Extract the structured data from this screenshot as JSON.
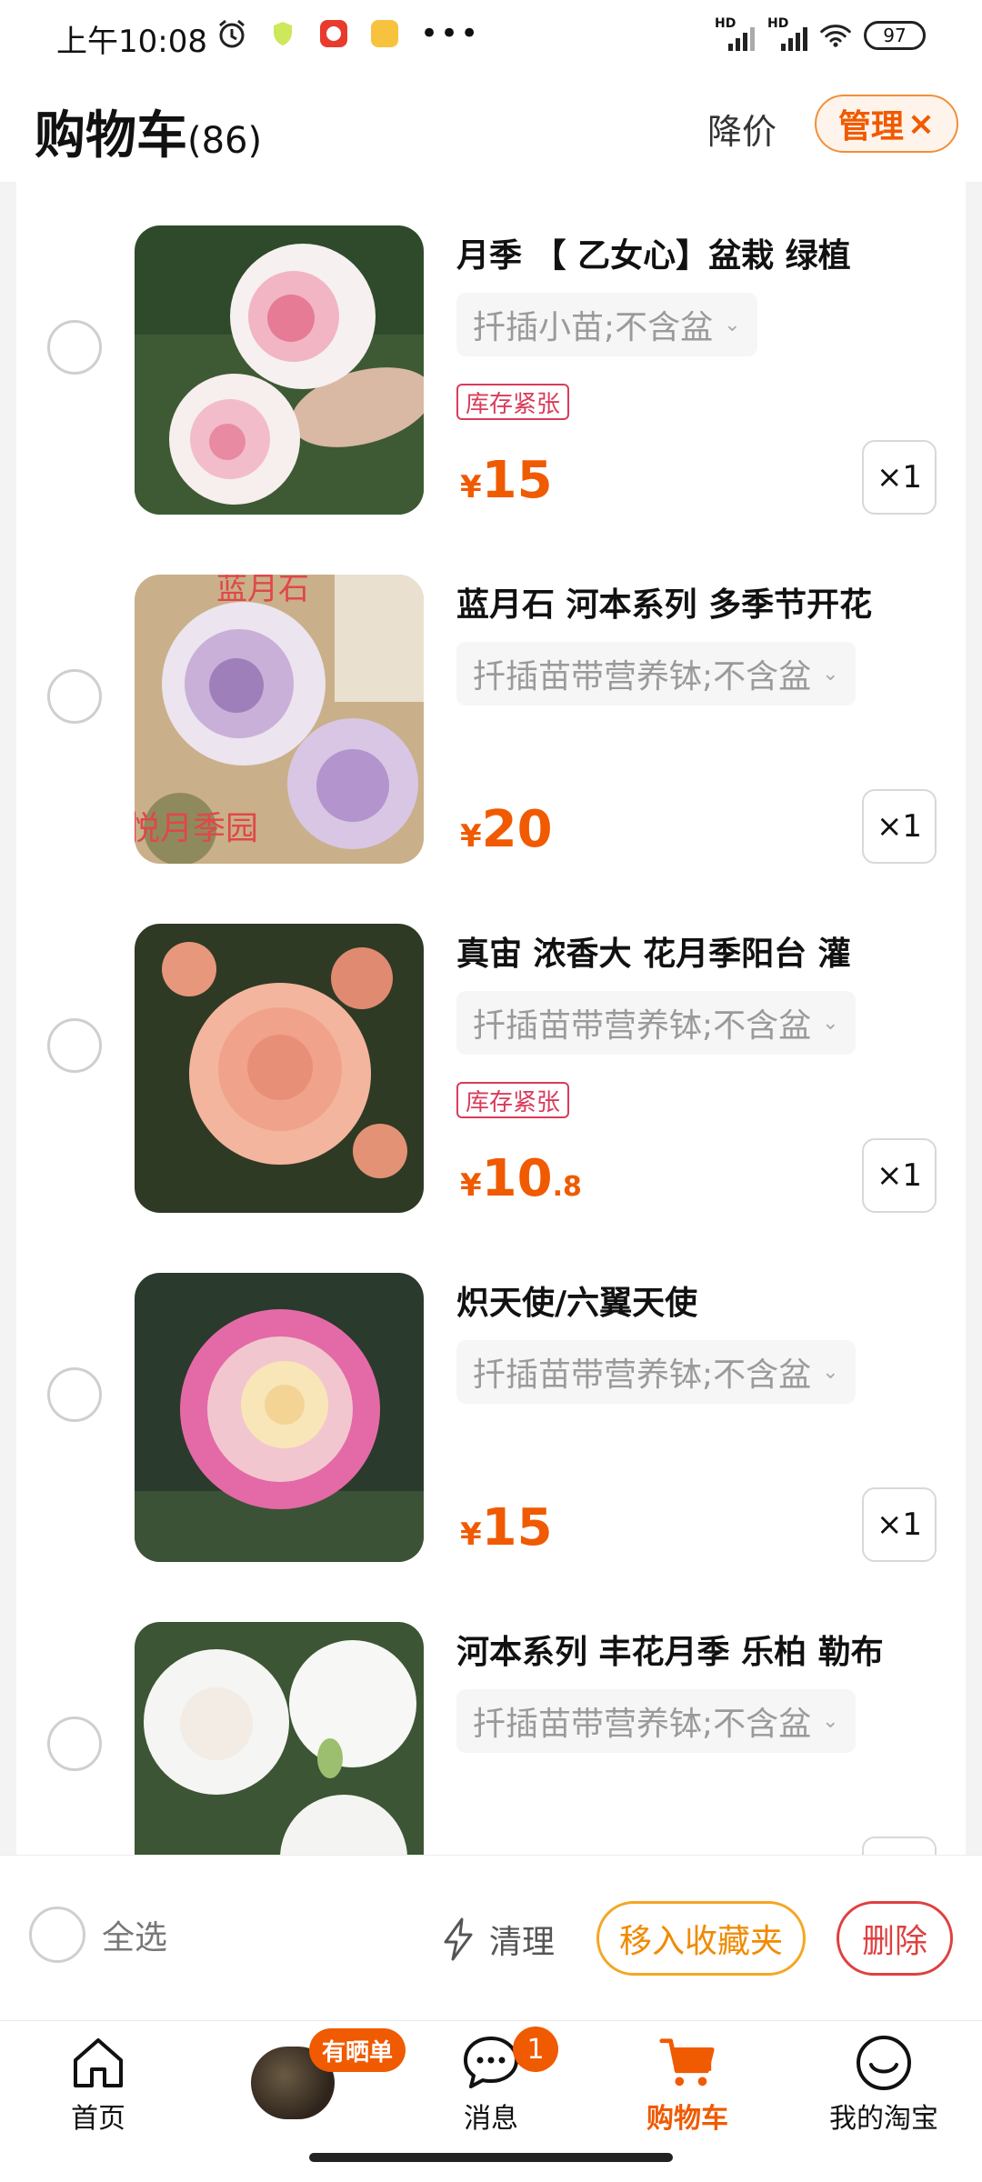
{
  "status_bar": {
    "time": "上午10:08",
    "signal1_label": "HD",
    "signal2_label": "HD",
    "battery": "97",
    "notification_icons": [
      "alarm-icon",
      "shield-icon",
      "app-notification-icon",
      "mini-app-icon"
    ],
    "overflow": "•••"
  },
  "header": {
    "title": "购物车",
    "count": "(86)",
    "price_drop": "降价",
    "manage": "管理",
    "manage_close": "×"
  },
  "items": [
    {
      "name": "月季 【 乙女心】盆栽 绿植",
      "sku": "扦插小苗;不含盆",
      "badge": "库存紧张",
      "price_symbol": "¥",
      "price_int": "15",
      "price_dec": "",
      "qty": "×1"
    },
    {
      "name": "蓝月石 河本系列 多季节开花",
      "sku": "扦插苗带营养钵;不含盆",
      "badge": "",
      "price_symbol": "¥",
      "price_int": "20",
      "price_dec": "",
      "qty": "×1",
      "image_text_top": "蓝月石",
      "image_text_bottom": "悦月季园"
    },
    {
      "name": "真宙  浓香大  花月季阳台  灌",
      "sku": "扦插苗带营养钵;不含盆",
      "badge": "库存紧张",
      "price_symbol": "¥",
      "price_int": "10",
      "price_dec": ".8",
      "qty": "×1"
    },
    {
      "name": "炽天使/六翼天使",
      "sku": "扦插苗带营养钵;不含盆",
      "badge": "",
      "price_symbol": "¥",
      "price_int": "15",
      "price_dec": "",
      "qty": "×1"
    },
    {
      "name": "河本系列 丰花月季 乐柏 勒布",
      "sku": "扦插苗带营养钵;不含盆",
      "badge": "",
      "price_symbol": "",
      "price_int": "",
      "price_dec": "",
      "qty": ""
    }
  ],
  "bottom_actions": {
    "select_all": "全选",
    "clean": "清理",
    "move_to_favorites": "移入收藏夹",
    "delete": "删除"
  },
  "tabbar": {
    "home": "首页",
    "promo_badge": "有晒单",
    "messages": "消息",
    "messages_badge": "1",
    "cart": "购物车",
    "my_taobao": "我的淘宝"
  },
  "colors": {
    "accent": "#f05a00",
    "stock_badge": "#d93b5a",
    "favorite_button": "#f5a623",
    "delete_button": "#e04040"
  }
}
